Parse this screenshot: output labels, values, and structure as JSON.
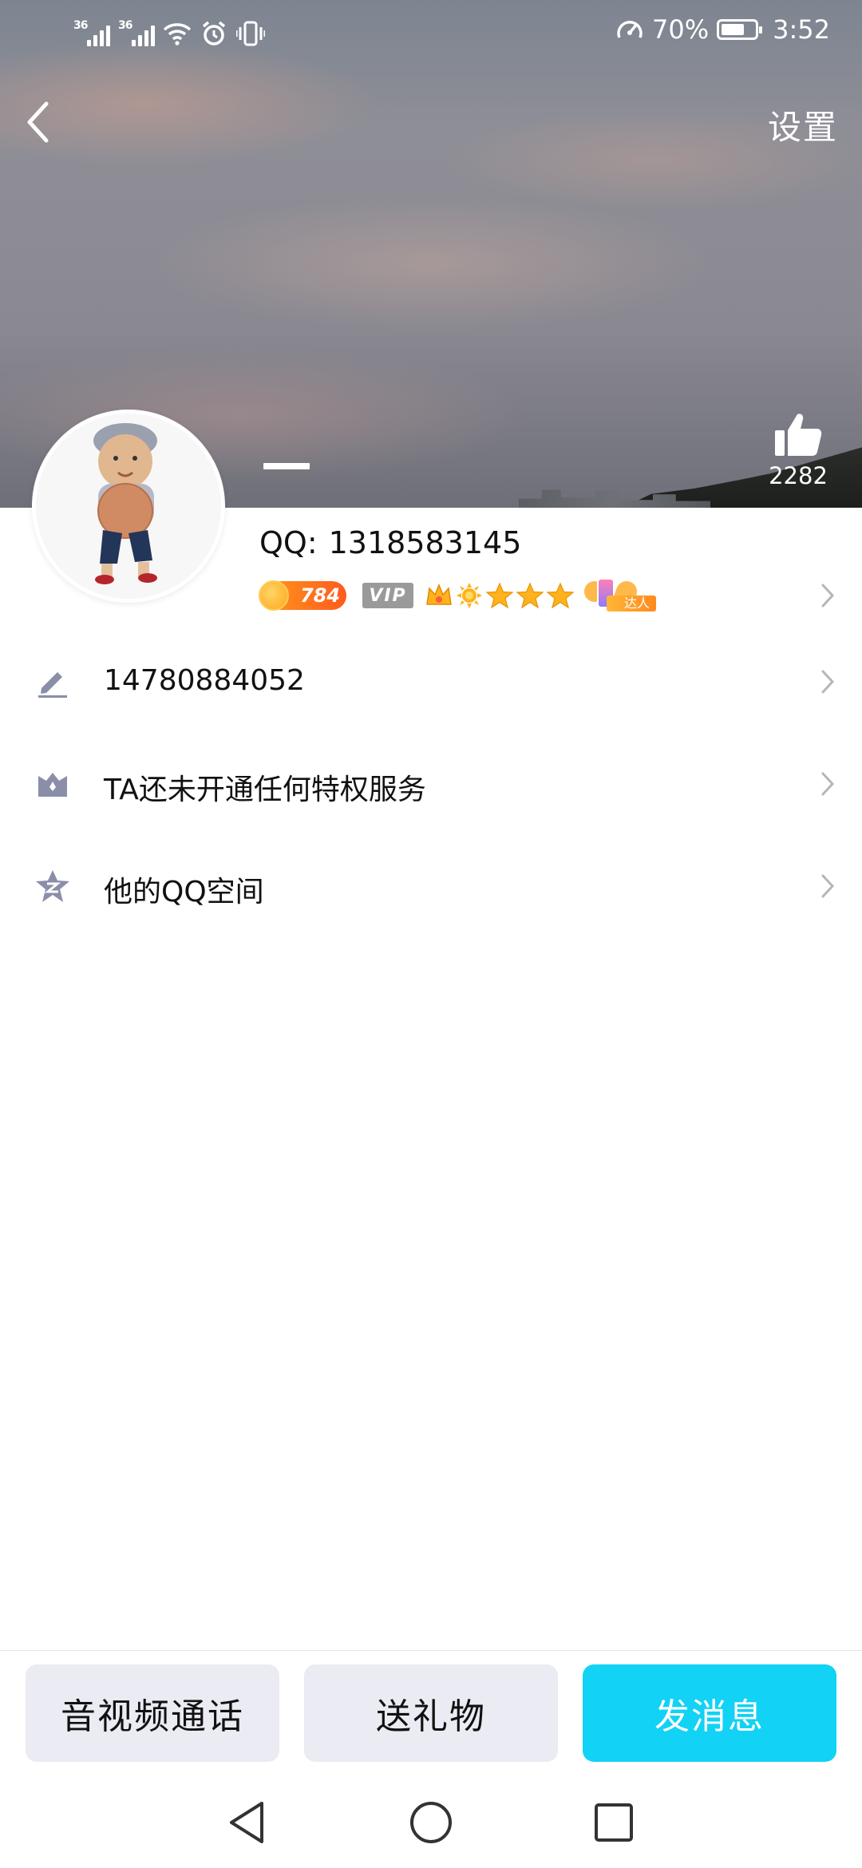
{
  "status_bar": {
    "sim1_network": "36",
    "sim2_network": "36",
    "battery_percent_text": "70%",
    "battery_level": 0.7,
    "time": "3:52",
    "icons": [
      "signal-icon",
      "wifi-icon",
      "alarm-icon",
      "vibrate-icon",
      "speedometer-icon",
      "battery-icon"
    ]
  },
  "nav": {
    "back_icon": "chevron-left-icon",
    "settings_label": "设置"
  },
  "profile": {
    "like_icon": "thumbs-up-icon",
    "like_count": "2282",
    "qq_label": "QQ:",
    "qq_number": "1318583145",
    "coin_level": "784",
    "vip_label": "VIP",
    "level_icons": [
      "crown-icon",
      "sun-icon",
      "star-icon",
      "star-icon",
      "star-icon"
    ],
    "talent_label": "达人"
  },
  "info_rows": [
    {
      "icon": "pencil-icon",
      "text": "14780884052"
    },
    {
      "icon": "crown-badge-icon",
      "text": "TA还未开通任何特权服务"
    },
    {
      "icon": "qzone-star-icon",
      "text": "他的QQ空间"
    }
  ],
  "actions": {
    "call_label": "音视频通话",
    "gift_label": "送礼物",
    "message_label": "发消息"
  },
  "colors": {
    "accent": "#12d2f5",
    "secondary_button": "#eaebf3",
    "icon_gray": "#8a8ea8",
    "coin_orange": "#ff6a1f"
  }
}
